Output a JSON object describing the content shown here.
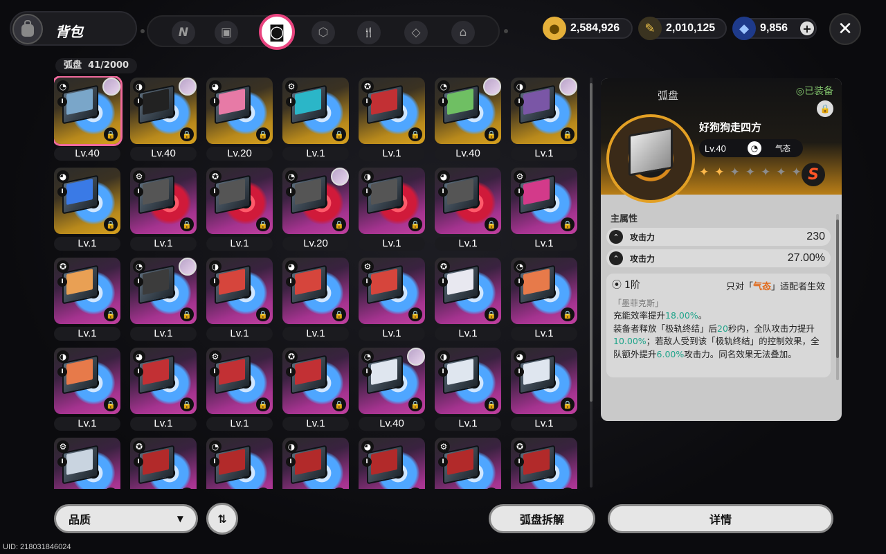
{
  "header": {
    "title": "背包",
    "tabs": [
      {
        "icon": "n-logo-icon",
        "glyph": "N"
      },
      {
        "icon": "gameboy-icon",
        "glyph": "▣"
      },
      {
        "icon": "disc-book-icon",
        "glyph": "◙"
      },
      {
        "icon": "cube-icon",
        "glyph": "⬡"
      },
      {
        "icon": "fork-spoon-icon",
        "glyph": "🍴"
      },
      {
        "icon": "drive-icon",
        "glyph": "◇"
      },
      {
        "icon": "house-icon",
        "glyph": "⌂"
      }
    ],
    "currencies": [
      {
        "icon": "coin-icon",
        "value": "2,584,926",
        "color": "#e5b03a"
      },
      {
        "icon": "ticket-icon",
        "value": "2,010,125",
        "color": "#f1c54a"
      },
      {
        "icon": "polychrome-icon",
        "value": "9,856",
        "color": "#3a73e6"
      }
    ],
    "close_icon": "close-icon"
  },
  "inventory": {
    "label": "弧盘",
    "count": "41/2000",
    "items": [
      {
        "lv": "Lv.40",
        "r": "s",
        "avatar": true,
        "art": "#7aa6c9"
      },
      {
        "lv": "Lv.40",
        "r": "s",
        "avatar": true,
        "art": "#222"
      },
      {
        "lv": "Lv.20",
        "r": "s",
        "avatar": false,
        "art": "#e77aa6"
      },
      {
        "lv": "Lv.1",
        "r": "s",
        "avatar": false,
        "art": "#2bb6c8"
      },
      {
        "lv": "Lv.1",
        "r": "s",
        "avatar": false,
        "art": "#c23034",
        "red": true
      },
      {
        "lv": "Lv.40",
        "r": "s",
        "avatar": true,
        "art": "#6fbf63"
      },
      {
        "lv": "Lv.1",
        "r": "s",
        "avatar": true,
        "art": "#7a56a6"
      },
      {
        "lv": "Lv.1",
        "r": "s",
        "avatar": false,
        "art": "#3a7ae6"
      },
      {
        "lv": "Lv.1",
        "r": "a",
        "avatar": false,
        "art": "#555",
        "red": true
      },
      {
        "lv": "Lv.1",
        "r": "a",
        "avatar": false,
        "art": "#555",
        "red": true
      },
      {
        "lv": "Lv.20",
        "r": "a",
        "avatar": true,
        "art": "#555",
        "red": true
      },
      {
        "lv": "Lv.1",
        "r": "a",
        "avatar": false,
        "art": "#555",
        "red": true
      },
      {
        "lv": "Lv.1",
        "r": "a",
        "avatar": false,
        "art": "#555",
        "red": true
      },
      {
        "lv": "Lv.1",
        "r": "a",
        "avatar": false,
        "art": "#d33a8a"
      },
      {
        "lv": "Lv.1",
        "r": "a",
        "avatar": false,
        "art": "#e9a054"
      },
      {
        "lv": "Lv.1",
        "r": "a",
        "avatar": true,
        "art": "#3c3c3c"
      },
      {
        "lv": "Lv.1",
        "r": "a",
        "avatar": false,
        "art": "#d6453c"
      },
      {
        "lv": "Lv.1",
        "r": "a",
        "avatar": false,
        "art": "#d6453c"
      },
      {
        "lv": "Lv.1",
        "r": "a",
        "avatar": false,
        "art": "#d6453c"
      },
      {
        "lv": "Lv.1",
        "r": "a",
        "avatar": false,
        "art": "#e8e8f0"
      },
      {
        "lv": "Lv.1",
        "r": "a",
        "avatar": false,
        "art": "#e77a4a"
      },
      {
        "lv": "Lv.1",
        "r": "a",
        "avatar": false,
        "art": "#e77a4a"
      },
      {
        "lv": "Lv.1",
        "r": "a",
        "avatar": false,
        "art": "#c23034"
      },
      {
        "lv": "Lv.1",
        "r": "a",
        "avatar": false,
        "art": "#c23034"
      },
      {
        "lv": "Lv.1",
        "r": "a",
        "avatar": false,
        "art": "#c23034"
      },
      {
        "lv": "Lv.40",
        "r": "a",
        "avatar": true,
        "art": "#dfe6ef"
      },
      {
        "lv": "Lv.1",
        "r": "a",
        "avatar": false,
        "art": "#dfe6ef"
      },
      {
        "lv": "Lv.1",
        "r": "a",
        "avatar": false,
        "art": "#dfe6ef"
      },
      {
        "lv": "",
        "r": "a",
        "avatar": false,
        "art": "#c9d4e0"
      },
      {
        "lv": "",
        "r": "a",
        "avatar": false,
        "art": "#b22a2a"
      },
      {
        "lv": "",
        "r": "a",
        "avatar": false,
        "art": "#b22a2a"
      },
      {
        "lv": "",
        "r": "a",
        "avatar": false,
        "art": "#b22a2a"
      },
      {
        "lv": "",
        "r": "a",
        "avatar": false,
        "art": "#b22a2a"
      },
      {
        "lv": "",
        "r": "a",
        "avatar": false,
        "art": "#b22a2a"
      },
      {
        "lv": "",
        "r": "a",
        "avatar": false,
        "art": "#b22a2a"
      }
    ]
  },
  "detail": {
    "type": "弧盘",
    "equipped": "◎已装备",
    "name": "好狗狗走四方",
    "level": "Lv.40",
    "attribute": "气态",
    "stars_total": 7,
    "stars_lit": 2,
    "rank": "S",
    "main_label": "主属性",
    "stats": [
      {
        "name": "攻击力",
        "value": "230"
      },
      {
        "name": "攻击力",
        "value": "27.00%"
      }
    ],
    "set": {
      "tier": "1阶",
      "cond_pre": "只对「",
      "cond_attr": "气态",
      "cond_post": "」适配者生效",
      "name": "「墨菲克斯」",
      "line1_pre": "充能效率提升",
      "line1_val": "18.00%",
      "line1_post": "。",
      "line2_a": "装备者释放「极轨终结」后",
      "line2_val1": "20",
      "line2_b": "秒内，全队攻击力提升",
      "line2_val2": "10.00%",
      "line2_c": "；若敌人受到该「极轨终结」的控制效果，全队额外提升",
      "line2_val3": "6.00%",
      "line2_d": "攻击力。同名效果无法叠加。"
    }
  },
  "footer": {
    "sort_label": "品质",
    "dismantle_label": "弧盘拆解",
    "details_label": "详情",
    "uid": "UID: 218031846024"
  }
}
